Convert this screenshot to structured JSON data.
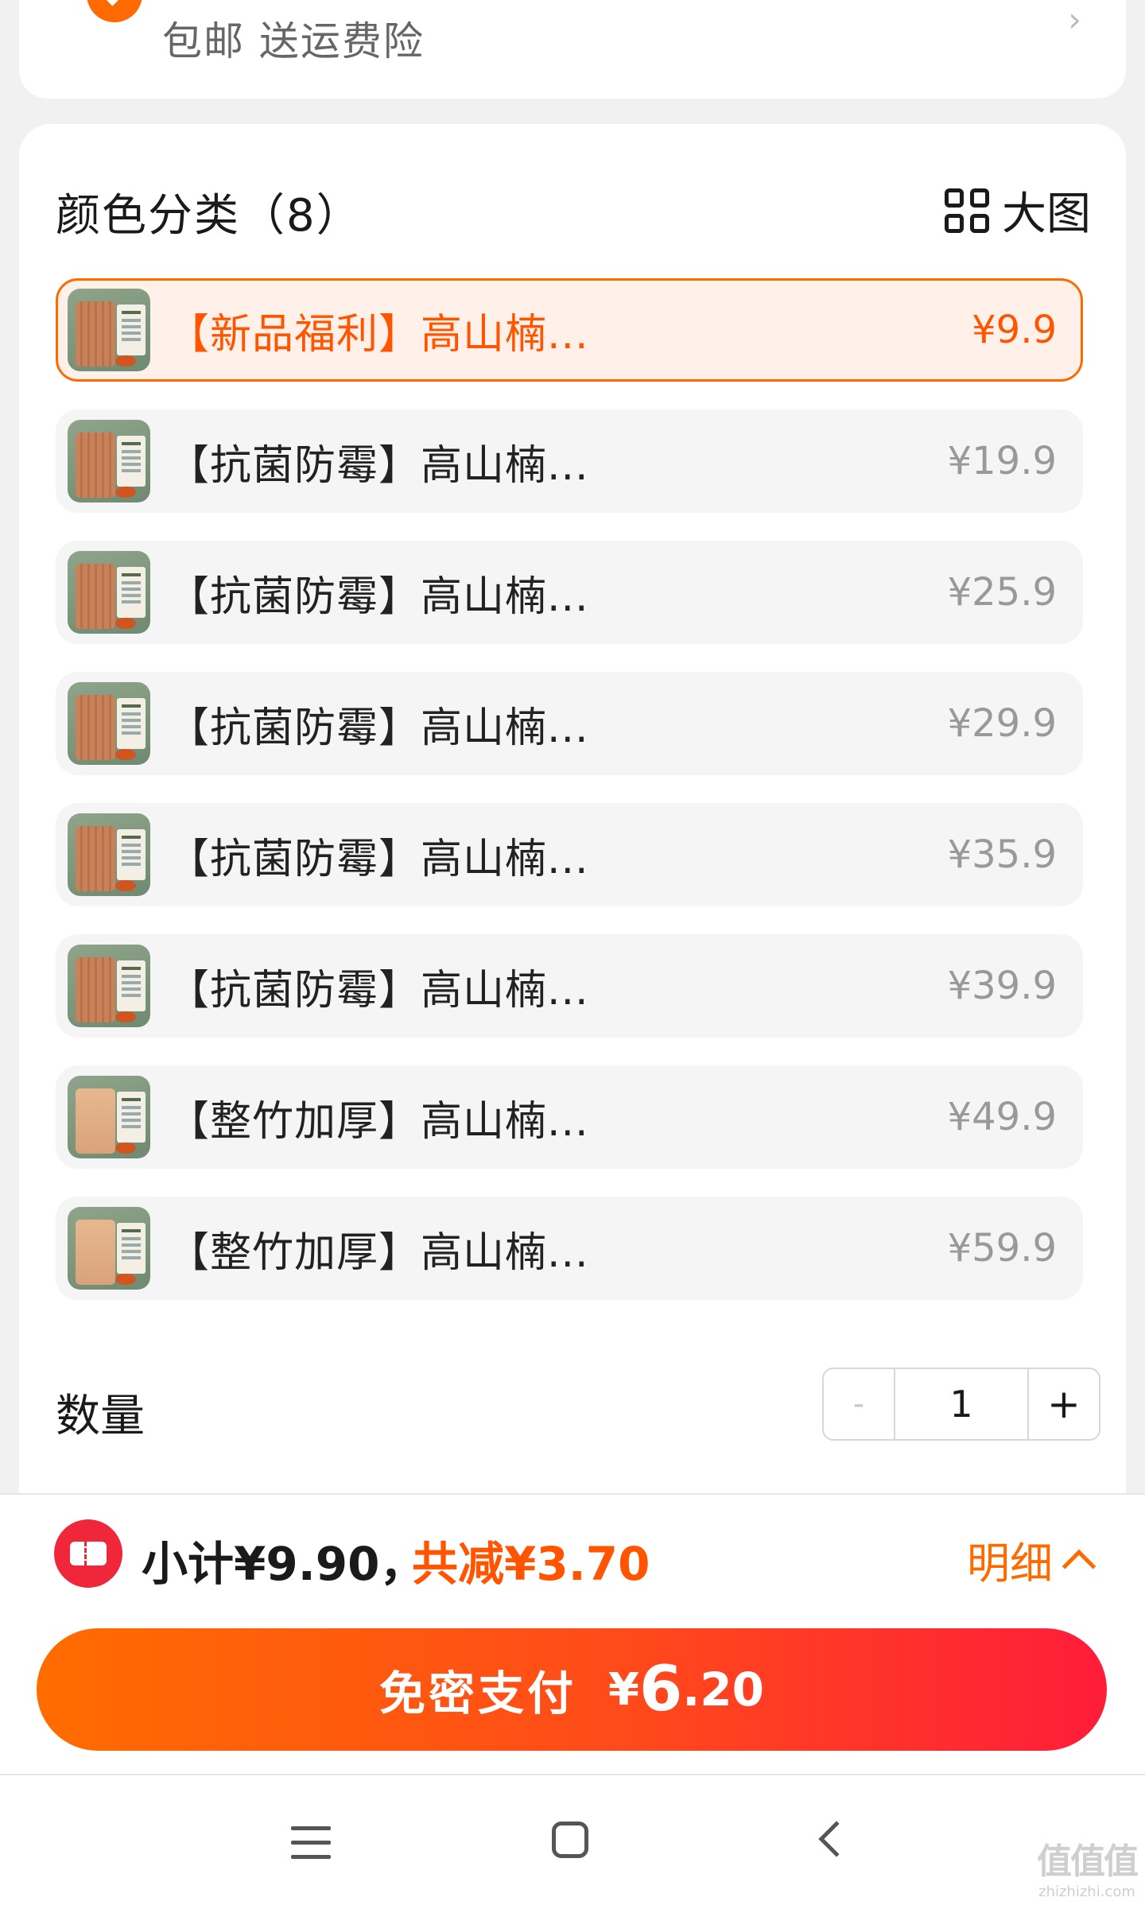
{
  "shipping": {
    "text": "包邮  送运费险"
  },
  "sku_section": {
    "title": "颜色分类（8）",
    "big_view_label": "大图",
    "items": [
      {
        "name": "【新品福利】高山楠...",
        "price": "¥9.9",
        "selected": true
      },
      {
        "name": "【抗菌防霉】高山楠...",
        "price": "¥19.9"
      },
      {
        "name": "【抗菌防霉】高山楠...",
        "price": "¥25.9"
      },
      {
        "name": "【抗菌防霉】高山楠...",
        "price": "¥29.9"
      },
      {
        "name": "【抗菌防霉】高山楠...",
        "price": "¥35.9"
      },
      {
        "name": "【抗菌防霉】高山楠...",
        "price": "¥39.9"
      },
      {
        "name": "【整竹加厚】高山楠...",
        "price": "¥49.9"
      },
      {
        "name": "【整竹加厚】高山楠...",
        "price": "¥59.9"
      }
    ]
  },
  "quantity": {
    "label": "数量",
    "minus": "-",
    "value": "1",
    "plus": "+"
  },
  "summary": {
    "subtotal": "小计¥9.90，",
    "discount": "共减¥3.70",
    "detail_label": "明细"
  },
  "pay_button": {
    "label": "免密支付",
    "currency": "¥",
    "amount_int": "6",
    "amount_dec": ".20"
  },
  "watermark": {
    "glyphs": "值值值",
    "url": "zhizhizhi.com"
  },
  "colors": {
    "accent": "#ff6a00",
    "price_orange": "#ff5500",
    "pay_start": "#ff6c00",
    "pay_end": "#ff1d3a"
  },
  "icons": [
    "shield-check-icon",
    "grid-icon",
    "coupon-icon",
    "chevron-up-icon",
    "menu-icon",
    "home-icon",
    "back-icon"
  ]
}
